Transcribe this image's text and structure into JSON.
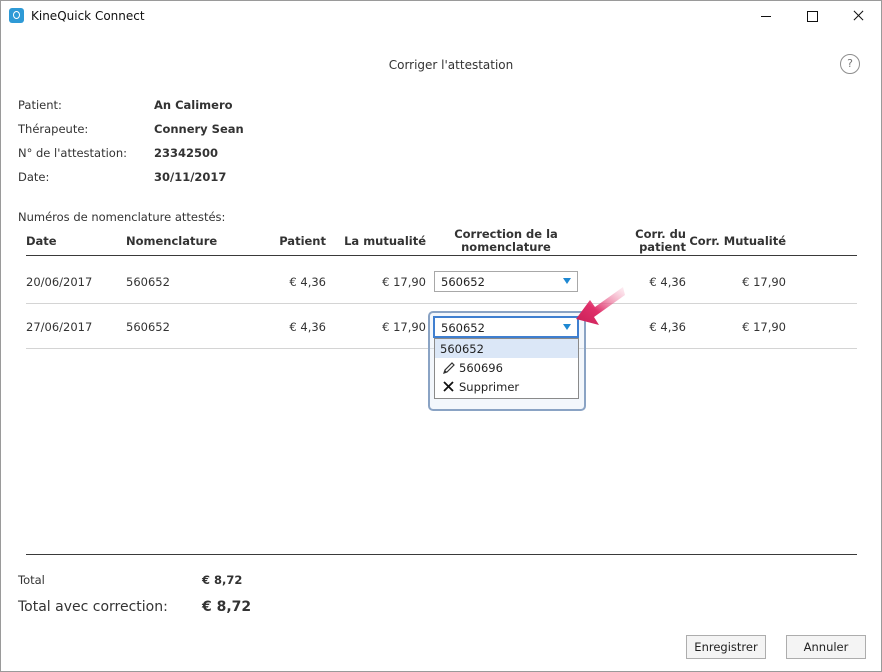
{
  "window": {
    "title": "KineQuick Connect"
  },
  "dialog": {
    "title": "Corriger l'attestation",
    "help": "?"
  },
  "info": [
    {
      "label": "Patient:",
      "value": "An Calimero"
    },
    {
      "label": "Thérapeute:",
      "value": "Connery Sean"
    },
    {
      "label": "N° de l'attestation:",
      "value": "23342500"
    },
    {
      "label": "Date:",
      "value": "30/11/2017"
    }
  ],
  "section_title": "Numéros de nomenclature attestés:",
  "table": {
    "headers": {
      "date": "Date",
      "nomenclature": "Nomenclature",
      "patient": "Patient",
      "mutualite": "La mutualité",
      "correction_line1": "Correction de la",
      "correction_line2": "nomenclature",
      "corr_patient_line1": "Corr. du",
      "corr_patient_line2": "patient",
      "corr_mutualite": "Corr. Mutualité"
    },
    "rows": [
      {
        "date": "20/06/2017",
        "nomenclature": "560652",
        "patient": "€ 4,36",
        "mutualite": "€ 17,90",
        "correction": "560652",
        "corr_patient": "€ 4,36",
        "corr_mutualite": "€ 17,90"
      },
      {
        "date": "27/06/2017",
        "nomenclature": "560652",
        "patient": "€ 4,36",
        "mutualite": "€ 17,90",
        "correction": "560652",
        "corr_patient": "€ 4,36",
        "corr_mutualite": "€ 17,90"
      }
    ]
  },
  "dropdown": {
    "options": [
      {
        "label": "560652",
        "icon": "none",
        "selected": true
      },
      {
        "label": "560696",
        "icon": "pencil-icon"
      },
      {
        "label": "Supprimer",
        "icon": "close-icon"
      }
    ]
  },
  "totals": {
    "total_label": "Total",
    "total_value": "€ 8,72",
    "corrected_label": "Total avec correction:",
    "corrected_value": "€ 8,72"
  },
  "buttons": {
    "save": "Enregistrer",
    "cancel": "Annuler"
  },
  "colors": {
    "accent": "#1e88d2",
    "pointer": "#e0306a",
    "focus": "#3f7fd0"
  }
}
